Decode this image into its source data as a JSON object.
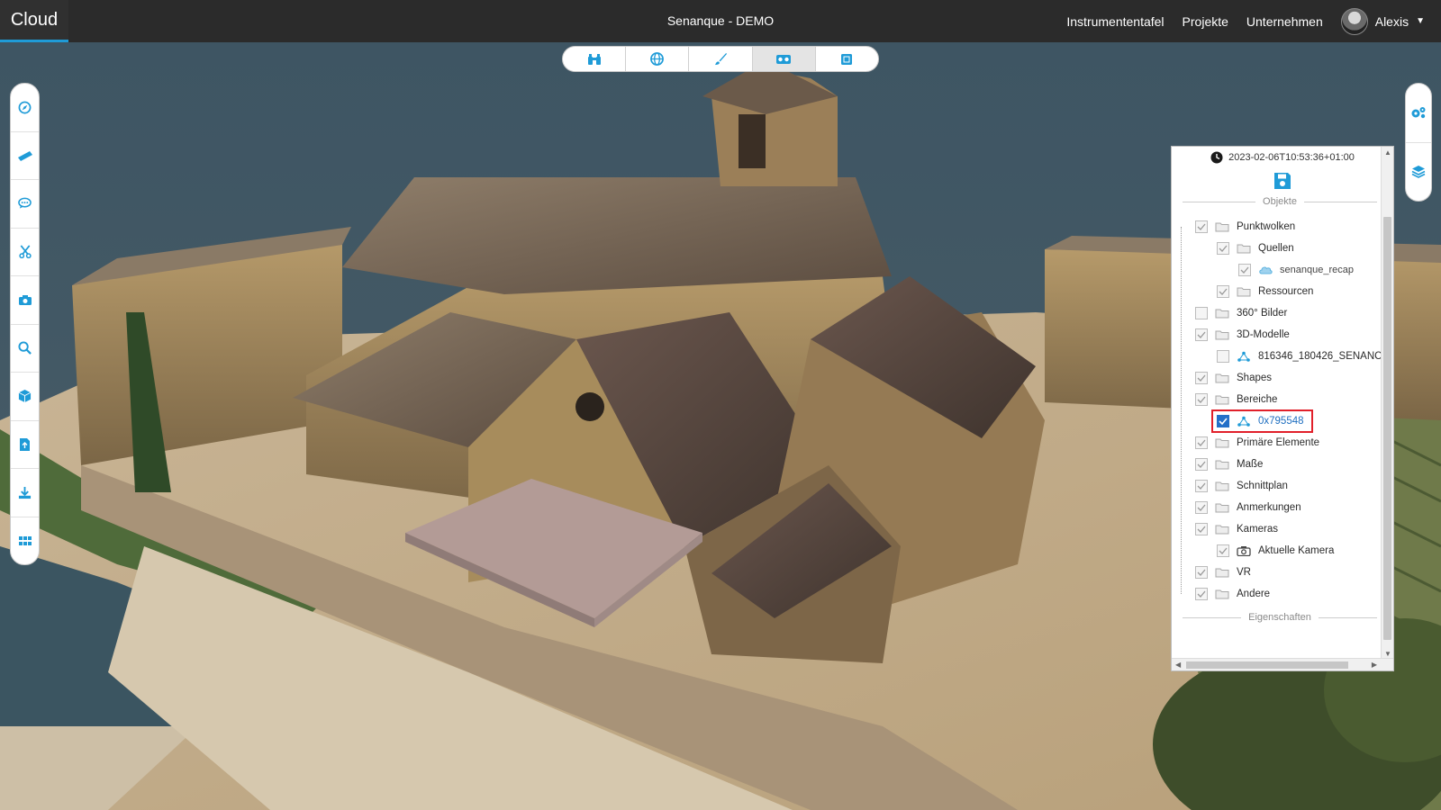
{
  "brand": "Cloud",
  "project_title": "Senanque - DEMO",
  "nav": [
    "Instrumententafel",
    "Projekte",
    "Unternehmen"
  ],
  "user": {
    "name": "Alexis"
  },
  "viewer_toolbar": [
    {
      "icon": "binoculars-icon",
      "active": false
    },
    {
      "icon": "globe-icon",
      "active": false
    },
    {
      "icon": "brush-icon",
      "active": false
    },
    {
      "icon": "vr-headset-icon",
      "active": true
    },
    {
      "icon": "cube-icon",
      "active": false
    }
  ],
  "left_toolbar": [
    "compass-icon",
    "ruler-icon",
    "comment-icon",
    "scissors-icon",
    "camera-icon",
    "search-icon",
    "box-icon",
    "file-upload-icon",
    "download-icon",
    "grid-icon"
  ],
  "right_toolbar": [
    "settings-gears-icon",
    "layers-icon"
  ],
  "panel": {
    "timestamp": "2023-02-06T10:53:36+01:00",
    "objects_title": "Objekte",
    "properties_title": "Eigenschaften",
    "tree": [
      {
        "label": "Punktwolken",
        "level": 1,
        "icon": "folder"
      },
      {
        "label": "Quellen",
        "level": 2,
        "icon": "folder"
      },
      {
        "label": "senanque_recap",
        "level": 3,
        "icon": "cloud"
      },
      {
        "label": "Ressourcen",
        "level": 2,
        "icon": "folder"
      },
      {
        "label": "360° Bilder",
        "level": 1,
        "icon": "folder"
      },
      {
        "label": "3D-Modelle",
        "level": 1,
        "icon": "folder"
      },
      {
        "label": "816346_180426_SENANC",
        "level": 2,
        "icon": "model"
      },
      {
        "label": "Shapes",
        "level": 1,
        "icon": "folder"
      },
      {
        "label": "Bereiche",
        "level": 1,
        "icon": "folder"
      },
      {
        "label": "0x795548",
        "level": 2,
        "icon": "model",
        "highlighted": true
      },
      {
        "label": "Primäre Elemente",
        "level": 1,
        "icon": "folder"
      },
      {
        "label": "Maße",
        "level": 1,
        "icon": "folder"
      },
      {
        "label": "Schnittplan",
        "level": 1,
        "icon": "folder"
      },
      {
        "label": "Anmerkungen",
        "level": 1,
        "icon": "folder"
      },
      {
        "label": "Kameras",
        "level": 1,
        "icon": "folder"
      },
      {
        "label": "Aktuelle Kamera",
        "level": 2,
        "icon": "camera"
      },
      {
        "label": "VR",
        "level": 1,
        "icon": "folder"
      },
      {
        "label": "Andere",
        "level": 1,
        "icon": "folder"
      }
    ]
  },
  "colors": {
    "topbar": "#2b2b2b",
    "accent": "#1f9bd7",
    "icon_blue": "#1f9bd7",
    "highlight": "#e1202a",
    "box_model": "#b39b96"
  }
}
